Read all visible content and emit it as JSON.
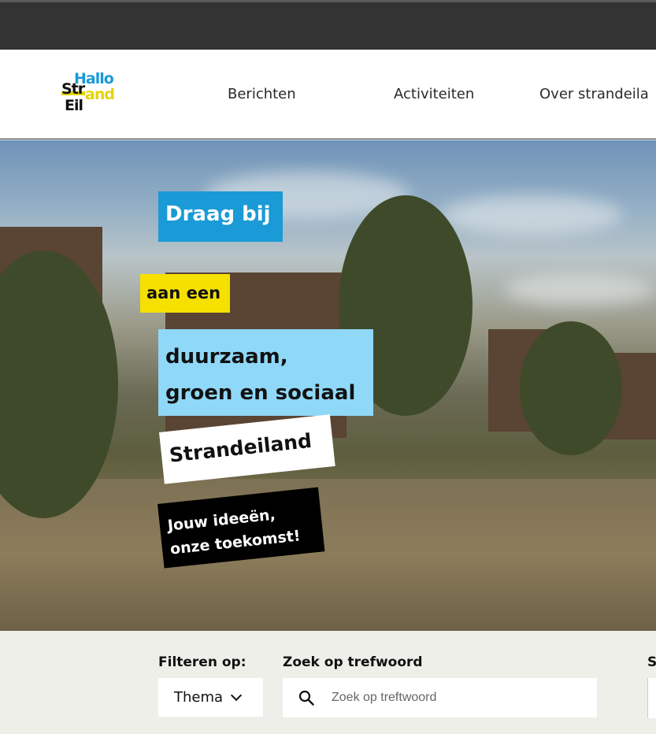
{
  "header": {
    "logo": {
      "line1": "Hallo",
      "line2": "Str",
      "line3": "and",
      "line4": "Eil"
    },
    "nav": [
      {
        "label": "Berichten"
      },
      {
        "label": "Activiteiten"
      },
      {
        "label": "Over strandeila"
      }
    ]
  },
  "hero": {
    "tag1": "Draag bij",
    "tag2": "aan een",
    "tag3_line1": "duurzaam,",
    "tag3_line2": "groen en sociaal",
    "tag4": "Strandeiland",
    "tag5_line1": "Jouw ideeën,",
    "tag5_line2": "onze toekomst!"
  },
  "filters": {
    "filter_label": "Filteren op:",
    "thema_value": "Thema",
    "search_label": "Zoek op trefwoord",
    "search_placeholder": "Zoek op treftwoord",
    "third_label": "S"
  },
  "colors": {
    "brand_blue": "#1a9ad6",
    "brand_yellow": "#f5e000",
    "light_blue": "#8fd8f8",
    "top_bar": "#333333",
    "filter_bg": "#efefe9"
  },
  "icons": [
    "search-icon",
    "chevron-down-icon"
  ]
}
